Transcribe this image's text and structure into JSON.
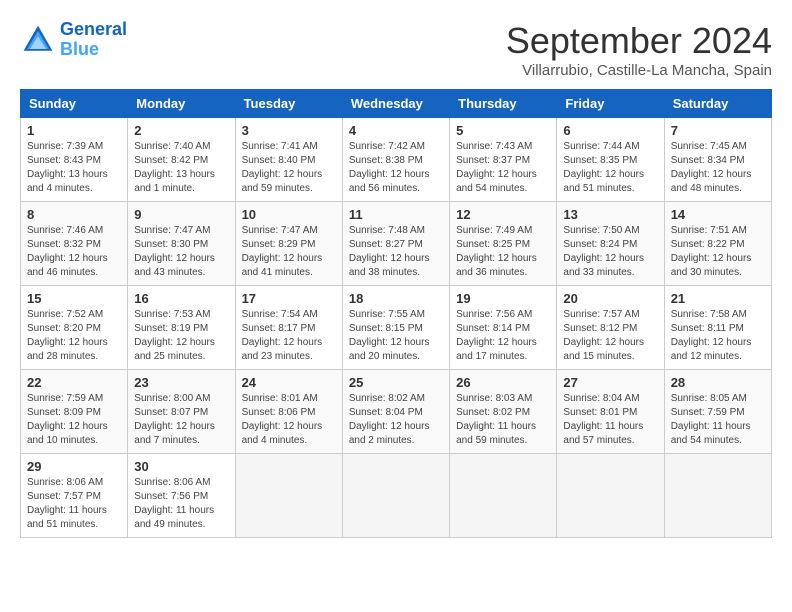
{
  "header": {
    "logo_line1": "General",
    "logo_line2": "Blue",
    "month": "September 2024",
    "location": "Villarrubio, Castille-La Mancha, Spain"
  },
  "weekdays": [
    "Sunday",
    "Monday",
    "Tuesday",
    "Wednesday",
    "Thursday",
    "Friday",
    "Saturday"
  ],
  "weeks": [
    [
      {
        "day": "1",
        "info": "Sunrise: 7:39 AM\nSunset: 8:43 PM\nDaylight: 13 hours\nand 4 minutes."
      },
      {
        "day": "2",
        "info": "Sunrise: 7:40 AM\nSunset: 8:42 PM\nDaylight: 13 hours\nand 1 minute."
      },
      {
        "day": "3",
        "info": "Sunrise: 7:41 AM\nSunset: 8:40 PM\nDaylight: 12 hours\nand 59 minutes."
      },
      {
        "day": "4",
        "info": "Sunrise: 7:42 AM\nSunset: 8:38 PM\nDaylight: 12 hours\nand 56 minutes."
      },
      {
        "day": "5",
        "info": "Sunrise: 7:43 AM\nSunset: 8:37 PM\nDaylight: 12 hours\nand 54 minutes."
      },
      {
        "day": "6",
        "info": "Sunrise: 7:44 AM\nSunset: 8:35 PM\nDaylight: 12 hours\nand 51 minutes."
      },
      {
        "day": "7",
        "info": "Sunrise: 7:45 AM\nSunset: 8:34 PM\nDaylight: 12 hours\nand 48 minutes."
      }
    ],
    [
      {
        "day": "8",
        "info": "Sunrise: 7:46 AM\nSunset: 8:32 PM\nDaylight: 12 hours\nand 46 minutes."
      },
      {
        "day": "9",
        "info": "Sunrise: 7:47 AM\nSunset: 8:30 PM\nDaylight: 12 hours\nand 43 minutes."
      },
      {
        "day": "10",
        "info": "Sunrise: 7:47 AM\nSunset: 8:29 PM\nDaylight: 12 hours\nand 41 minutes."
      },
      {
        "day": "11",
        "info": "Sunrise: 7:48 AM\nSunset: 8:27 PM\nDaylight: 12 hours\nand 38 minutes."
      },
      {
        "day": "12",
        "info": "Sunrise: 7:49 AM\nSunset: 8:25 PM\nDaylight: 12 hours\nand 36 minutes."
      },
      {
        "day": "13",
        "info": "Sunrise: 7:50 AM\nSunset: 8:24 PM\nDaylight: 12 hours\nand 33 minutes."
      },
      {
        "day": "14",
        "info": "Sunrise: 7:51 AM\nSunset: 8:22 PM\nDaylight: 12 hours\nand 30 minutes."
      }
    ],
    [
      {
        "day": "15",
        "info": "Sunrise: 7:52 AM\nSunset: 8:20 PM\nDaylight: 12 hours\nand 28 minutes."
      },
      {
        "day": "16",
        "info": "Sunrise: 7:53 AM\nSunset: 8:19 PM\nDaylight: 12 hours\nand 25 minutes."
      },
      {
        "day": "17",
        "info": "Sunrise: 7:54 AM\nSunset: 8:17 PM\nDaylight: 12 hours\nand 23 minutes."
      },
      {
        "day": "18",
        "info": "Sunrise: 7:55 AM\nSunset: 8:15 PM\nDaylight: 12 hours\nand 20 minutes."
      },
      {
        "day": "19",
        "info": "Sunrise: 7:56 AM\nSunset: 8:14 PM\nDaylight: 12 hours\nand 17 minutes."
      },
      {
        "day": "20",
        "info": "Sunrise: 7:57 AM\nSunset: 8:12 PM\nDaylight: 12 hours\nand 15 minutes."
      },
      {
        "day": "21",
        "info": "Sunrise: 7:58 AM\nSunset: 8:11 PM\nDaylight: 12 hours\nand 12 minutes."
      }
    ],
    [
      {
        "day": "22",
        "info": "Sunrise: 7:59 AM\nSunset: 8:09 PM\nDaylight: 12 hours\nand 10 minutes."
      },
      {
        "day": "23",
        "info": "Sunrise: 8:00 AM\nSunset: 8:07 PM\nDaylight: 12 hours\nand 7 minutes."
      },
      {
        "day": "24",
        "info": "Sunrise: 8:01 AM\nSunset: 8:06 PM\nDaylight: 12 hours\nand 4 minutes."
      },
      {
        "day": "25",
        "info": "Sunrise: 8:02 AM\nSunset: 8:04 PM\nDaylight: 12 hours\nand 2 minutes."
      },
      {
        "day": "26",
        "info": "Sunrise: 8:03 AM\nSunset: 8:02 PM\nDaylight: 11 hours\nand 59 minutes."
      },
      {
        "day": "27",
        "info": "Sunrise: 8:04 AM\nSunset: 8:01 PM\nDaylight: 11 hours\nand 57 minutes."
      },
      {
        "day": "28",
        "info": "Sunrise: 8:05 AM\nSunset: 7:59 PM\nDaylight: 11 hours\nand 54 minutes."
      }
    ],
    [
      {
        "day": "29",
        "info": "Sunrise: 8:06 AM\nSunset: 7:57 PM\nDaylight: 11 hours\nand 51 minutes."
      },
      {
        "day": "30",
        "info": "Sunrise: 8:06 AM\nSunset: 7:56 PM\nDaylight: 11 hours\nand 49 minutes."
      },
      {
        "day": "",
        "info": ""
      },
      {
        "day": "",
        "info": ""
      },
      {
        "day": "",
        "info": ""
      },
      {
        "day": "",
        "info": ""
      },
      {
        "day": "",
        "info": ""
      }
    ]
  ]
}
